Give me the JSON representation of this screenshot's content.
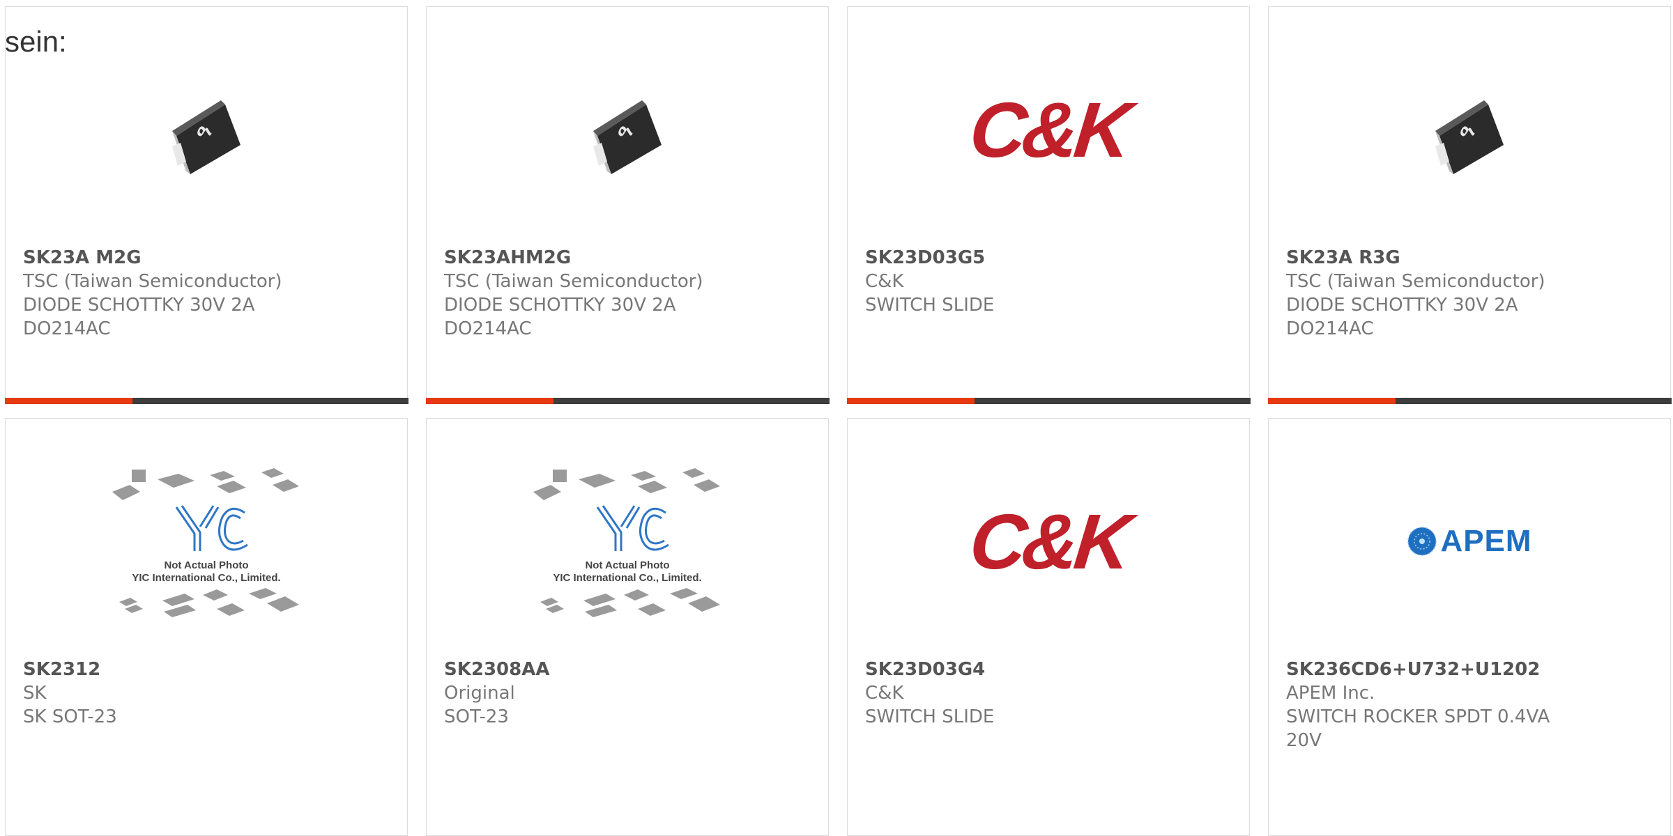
{
  "page": {
    "intro_text": "sein:"
  },
  "colors": {
    "accent_bar": "#e63a11",
    "bar_dark": "#3d3d3d",
    "ck_red": "#c0202a",
    "apem_blue": "#1f6fc0",
    "yic_blue": "#2f76c6",
    "text_gray": "#777777"
  },
  "products": [
    {
      "part": "SK23A M2G",
      "maker": "TSC (Taiwan Semiconductor)",
      "desc": [
        "DIODE SCHOTTKY 30V 2A",
        "DO214AC"
      ],
      "image": "diode-image"
    },
    {
      "part": "SK23AHM2G",
      "maker": "TSC (Taiwan Semiconductor)",
      "desc": [
        "DIODE SCHOTTKY 30V 2A",
        "DO214AC"
      ],
      "image": "diode-image"
    },
    {
      "part": "SK23D03G5",
      "maker": "C&K",
      "desc": [
        "SWITCH SLIDE",
        ""
      ],
      "image": "ck-logo"
    },
    {
      "part": "SK23A R3G",
      "maker": "TSC (Taiwan Semiconductor)",
      "desc": [
        "DIODE SCHOTTKY 30V 2A",
        "DO214AC"
      ],
      "image": "diode-image"
    },
    {
      "part": "SK2312",
      "maker": "SK",
      "desc": [
        "SK SOT-23",
        ""
      ],
      "image": "yic-placeholder"
    },
    {
      "part": "SK2308AA",
      "maker": "Original",
      "desc": [
        "SOT-23",
        ""
      ],
      "image": "yic-placeholder"
    },
    {
      "part": "SK23D03G4",
      "maker": "C&K",
      "desc": [
        "SWITCH SLIDE",
        ""
      ],
      "image": "ck-logo"
    },
    {
      "part": "SK236CD6+U732+U1202",
      "maker": "APEM Inc.",
      "desc": [
        "SWITCH ROCKER SPDT 0.4VA",
        "20V"
      ],
      "image": "apem-logo"
    }
  ],
  "logos": {
    "ck": "C&K",
    "apem": "APEM",
    "yic_mark": "YIC",
    "yic_caption1": "Not Actual Photo",
    "yic_caption2": "YIC International Co., Limited."
  }
}
